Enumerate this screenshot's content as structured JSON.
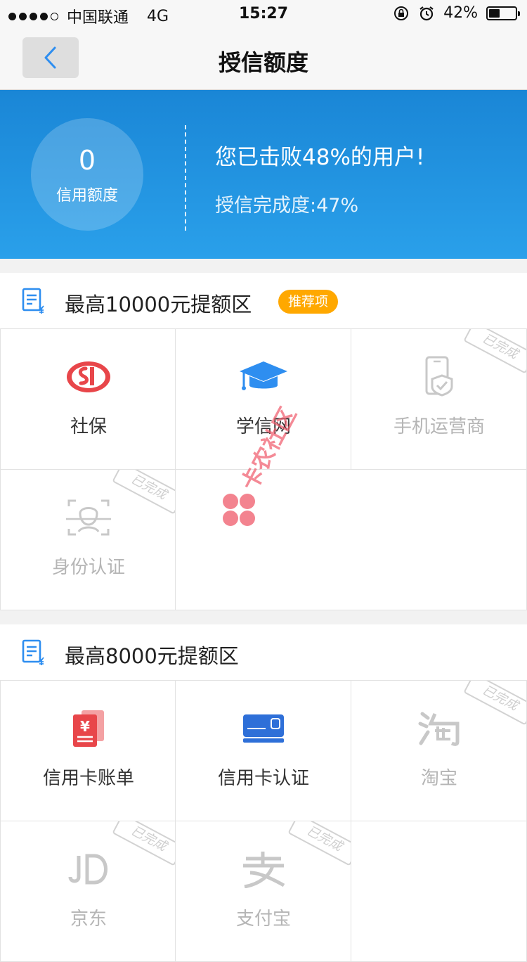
{
  "status_bar": {
    "carrier": "中国联通",
    "network": "4G",
    "time": "15:27",
    "battery": "42%",
    "battery_level": 0.42
  },
  "nav": {
    "title": "授信额度",
    "back_icon": "chevron-left-icon"
  },
  "summary": {
    "credit_value": "0",
    "credit_label": "信用额度",
    "beat_text": "您已击败48%的用户!",
    "progress_text": "授信完成度:47%"
  },
  "sections": [
    {
      "title": "最高10000元提额区",
      "badge": "推荐项",
      "items": [
        {
          "label": "社保",
          "icon": "social-security-icon",
          "done": false
        },
        {
          "label": "学信网",
          "icon": "graduation-cap-icon",
          "done": false
        },
        {
          "label": "手机运营商",
          "icon": "phone-check-icon",
          "done": true
        },
        {
          "label": "身份认证",
          "icon": "face-scan-icon",
          "done": true
        }
      ]
    },
    {
      "title": "最高8000元提额区",
      "items": [
        {
          "label": "信用卡账单",
          "icon": "bill-icon",
          "done": false
        },
        {
          "label": "信用卡认证",
          "icon": "credit-card-icon",
          "done": false
        },
        {
          "label": "淘宝",
          "icon": "taobao-icon",
          "done": true
        },
        {
          "label": "京东",
          "icon": "jd-icon",
          "done": true
        },
        {
          "label": "支付宝",
          "icon": "alipay-icon",
          "done": true
        }
      ]
    }
  ],
  "stamp_text": "已完成",
  "watermark_text": "卡农社区",
  "colors": {
    "banner_top": "#1a86d6",
    "banner_bottom": "#2aa0ea",
    "badge": "#ffa800",
    "icon_blue": "#2e8ef0",
    "icon_red": "#e8464a",
    "done_gray": "#c8c8c8"
  }
}
